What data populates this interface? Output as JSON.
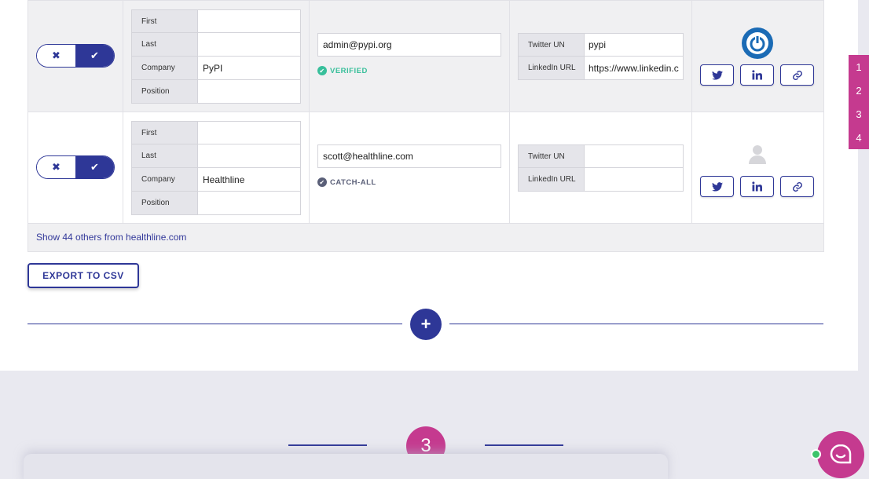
{
  "rows": [
    {
      "fields": [
        {
          "label": "First",
          "value": ""
        },
        {
          "label": "Last",
          "value": ""
        },
        {
          "label": "Company",
          "value": "PyPI"
        },
        {
          "label": "Position",
          "value": ""
        }
      ],
      "email": "admin@pypi.org",
      "status": "VERIFIED",
      "social": [
        {
          "label": "Twitter UN",
          "value": "pypi"
        },
        {
          "label": "LinkedIn URL",
          "value": "https://www.linkedin.c"
        }
      ]
    },
    {
      "fields": [
        {
          "label": "First",
          "value": ""
        },
        {
          "label": "Last",
          "value": ""
        },
        {
          "label": "Company",
          "value": "Healthline"
        },
        {
          "label": "Position",
          "value": ""
        }
      ],
      "email": "scott@healthline.com",
      "status": "CATCH-ALL",
      "social": [
        {
          "label": "Twitter UN",
          "value": ""
        },
        {
          "label": "LinkedIn URL",
          "value": ""
        }
      ]
    }
  ],
  "footer": {
    "show_others": "Show 44 others from healthline.com"
  },
  "export_label": "EXPORT TO CSV",
  "add_label": "+",
  "pager": [
    "1",
    "2",
    "3",
    "4"
  ],
  "step_number": "3",
  "icons": {
    "reject": "close-icon",
    "accept": "check-icon",
    "twitter": "twitter-icon",
    "linkedin": "linkedin-icon",
    "link": "link-icon",
    "chat": "chat-icon"
  },
  "colors": {
    "primary": "#2e3797",
    "accent": "#c53a8f",
    "verified": "#38bf9b",
    "catch_all": "#5a5f78"
  }
}
